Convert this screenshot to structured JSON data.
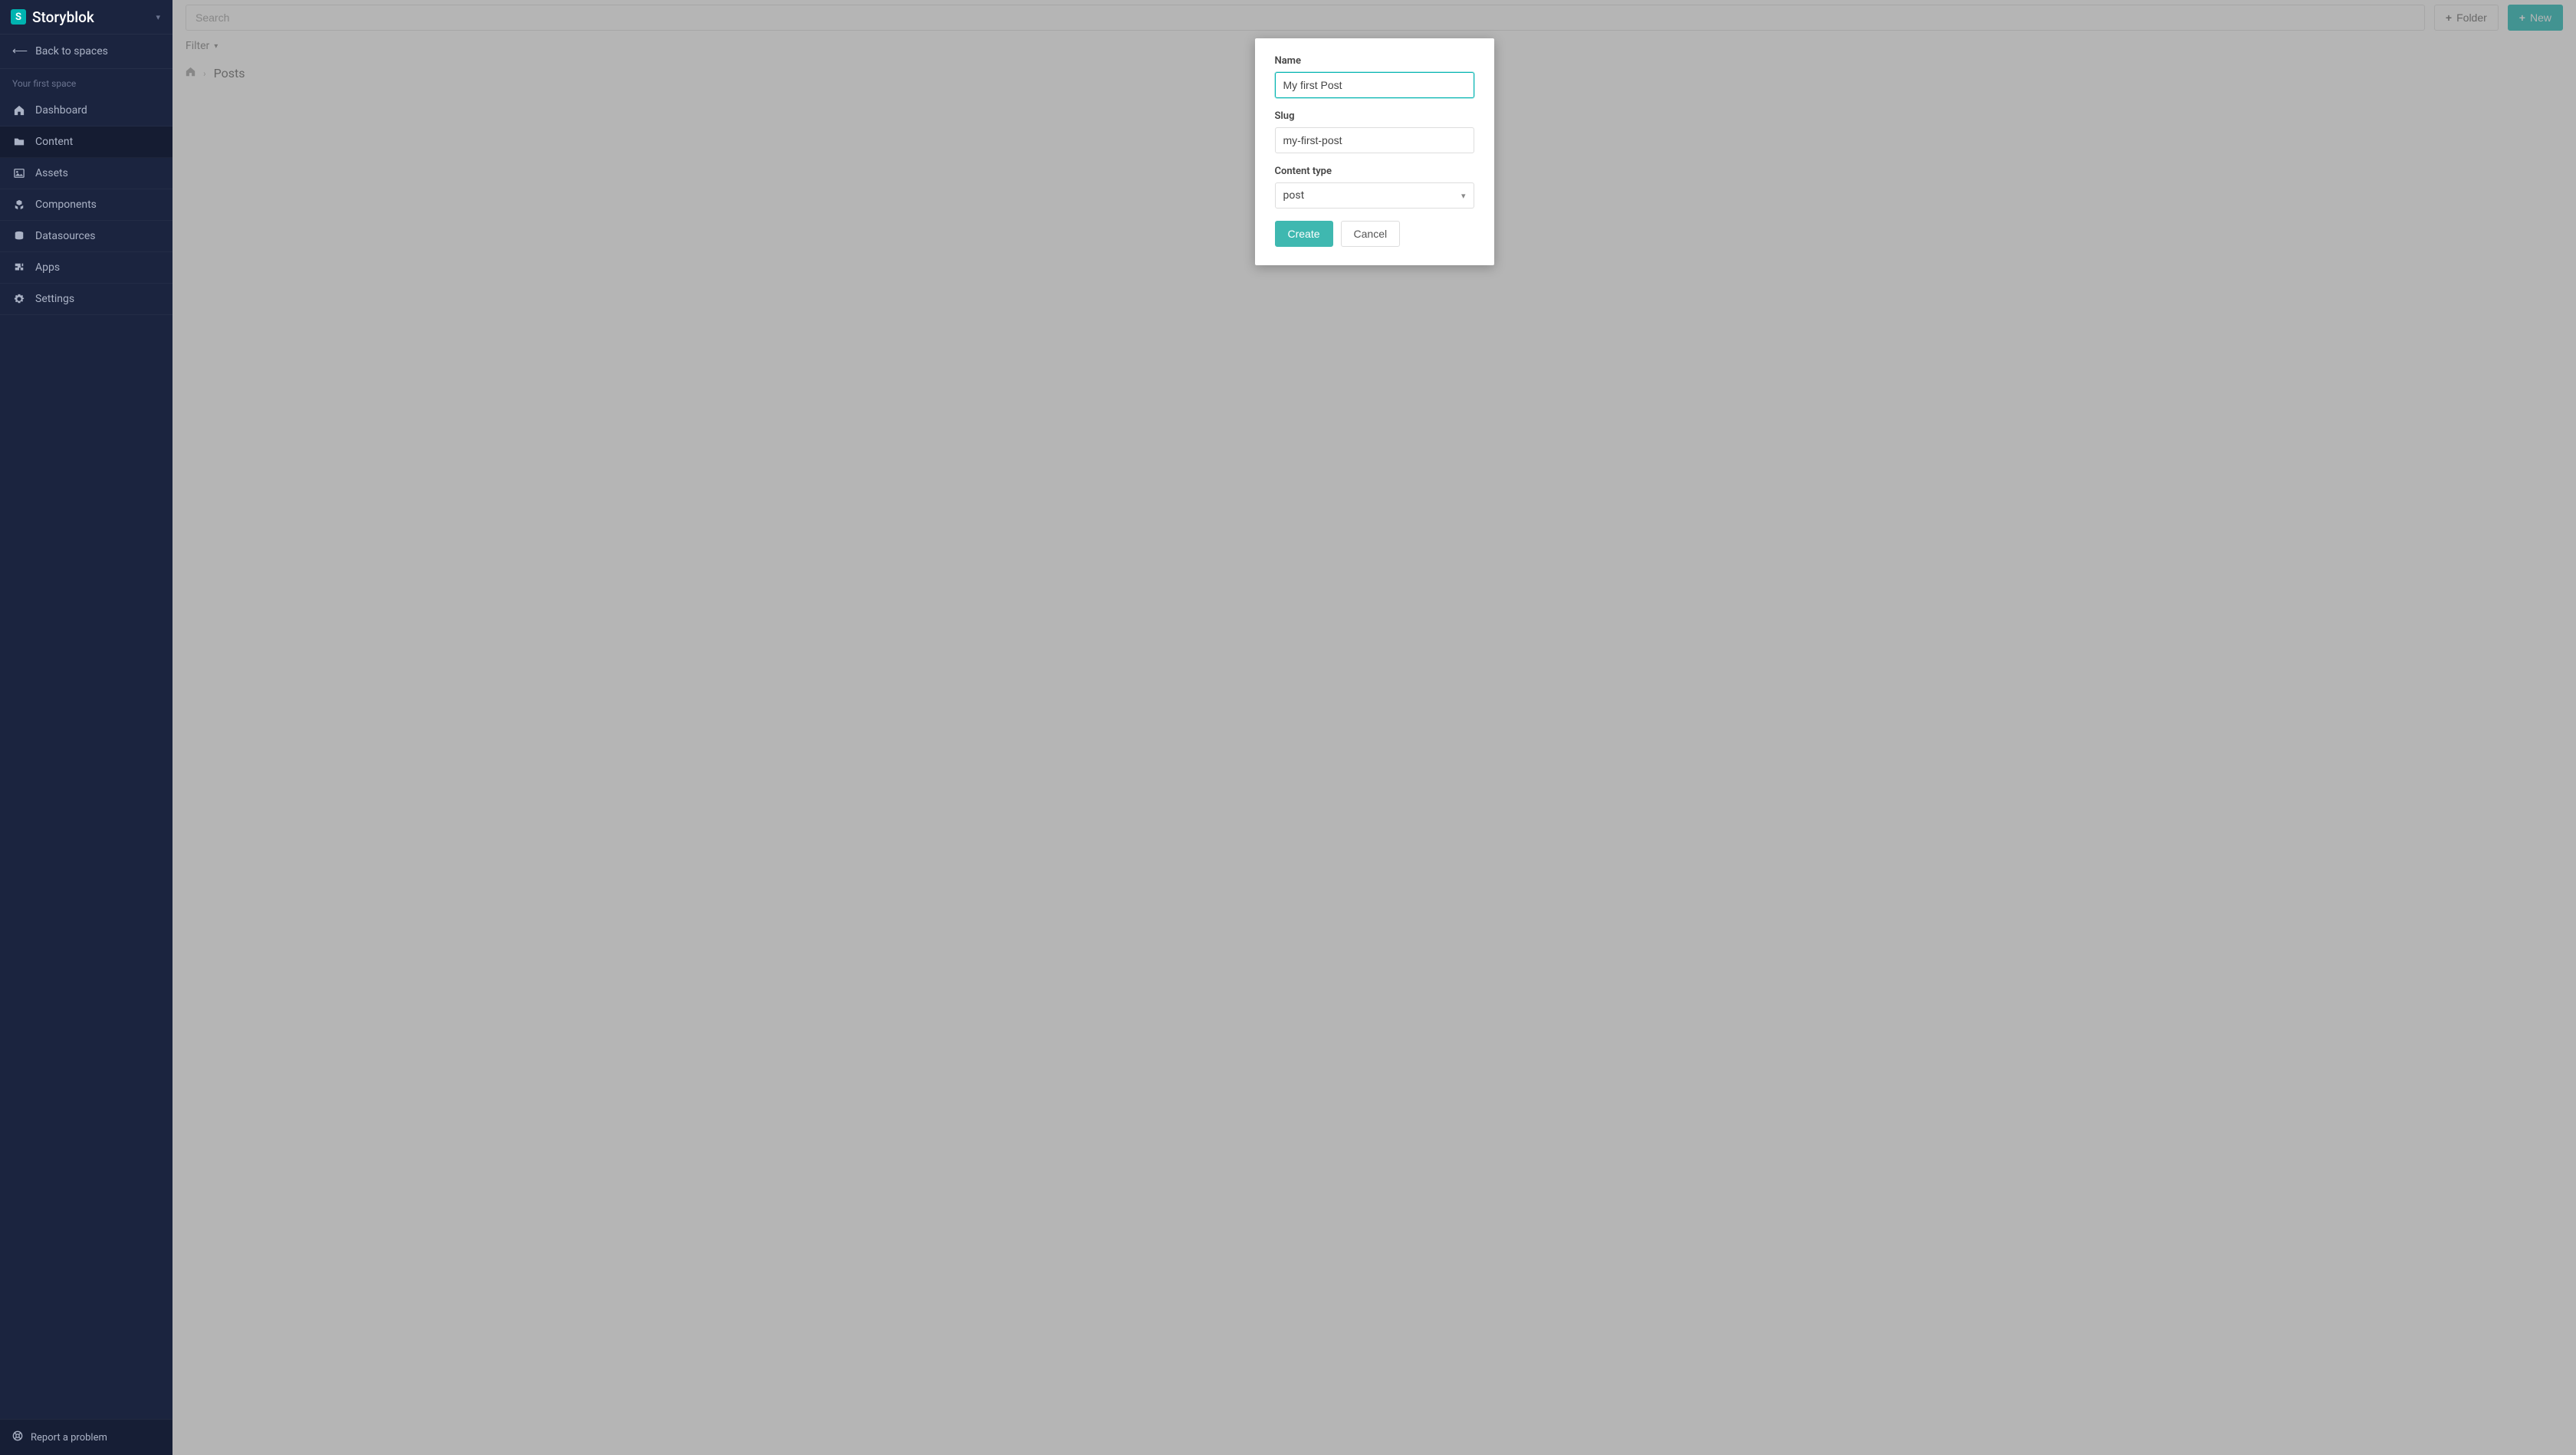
{
  "app": {
    "name": "Storyblok",
    "logo_glyph": "S"
  },
  "sidebar": {
    "back_label": "Back to spaces",
    "space_name": "Your first space",
    "items": [
      {
        "label": "Dashboard",
        "icon": "home-icon"
      },
      {
        "label": "Content",
        "icon": "folder-icon"
      },
      {
        "label": "Assets",
        "icon": "image-icon"
      },
      {
        "label": "Components",
        "icon": "cubes-icon"
      },
      {
        "label": "Datasources",
        "icon": "database-icon"
      },
      {
        "label": "Apps",
        "icon": "puzzle-icon"
      },
      {
        "label": "Settings",
        "icon": "gear-icon"
      }
    ],
    "footer_label": "Report a problem"
  },
  "topbar": {
    "search_placeholder": "Search",
    "folder_button": "Folder",
    "new_button": "New"
  },
  "filter": {
    "label": "Filter"
  },
  "breadcrumb": {
    "current": "Posts"
  },
  "modal": {
    "fields": {
      "name": {
        "label": "Name",
        "value": "My first Post"
      },
      "slug": {
        "label": "Slug",
        "value": "my-first-post"
      },
      "content_type": {
        "label": "Content type",
        "value": "post"
      }
    },
    "actions": {
      "create": "Create",
      "cancel": "Cancel"
    }
  }
}
